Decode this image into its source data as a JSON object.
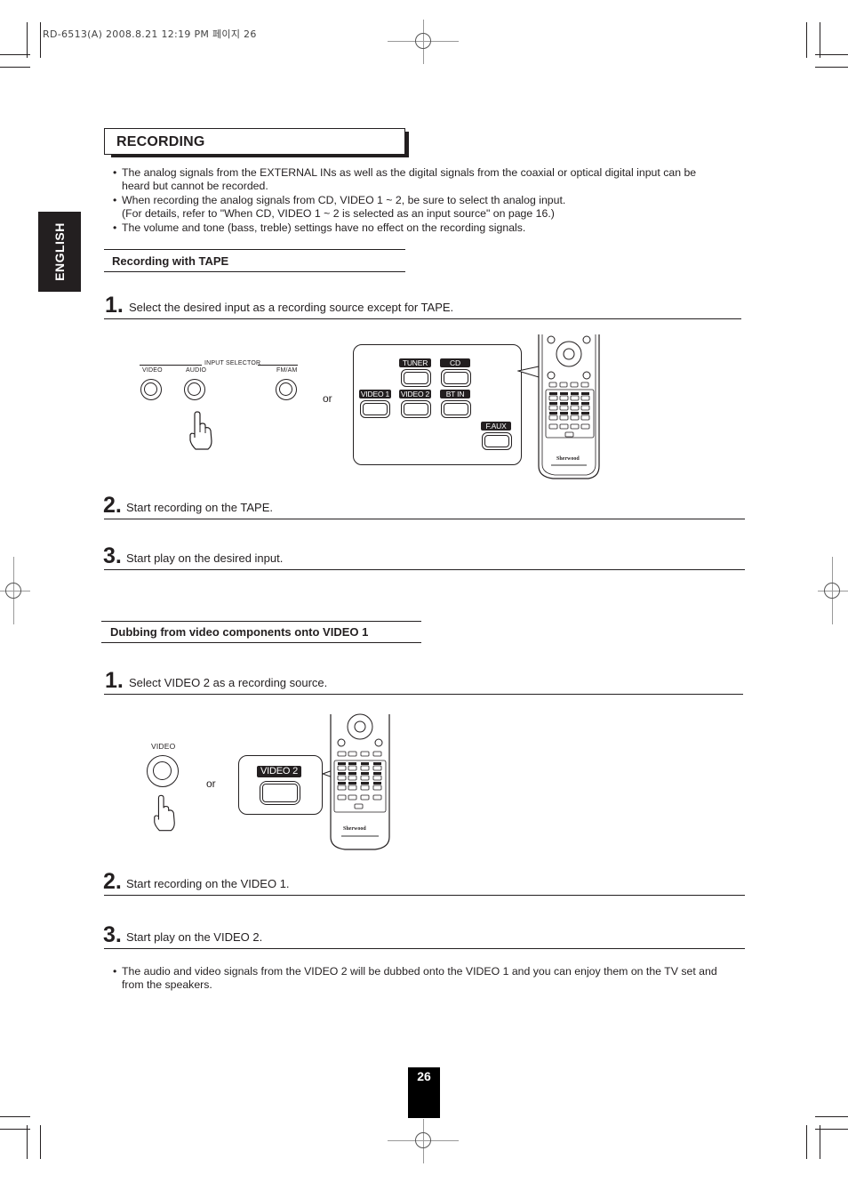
{
  "header": {
    "stamp": "RD-6513(A)  2008.8.21  12:19 PM  페이지 26"
  },
  "side_tab": {
    "language": "ENGLISH"
  },
  "section": {
    "title": "RECORDING",
    "notes": [
      "The analog signals from the EXTERNAL INs as well as the digital signals from the coaxial or optical digital input can be",
      "heard but cannot be recorded.",
      "When recording the analog signals from CD, VIDEO 1 ~ 2, be sure to select th analog input.",
      "(For details, refer to \"When CD, VIDEO 1 ~ 2 is selected as an input source\" on page 16.)",
      "The volume and tone (bass, treble) settings have no effect on the recording signals."
    ],
    "bullet": "•"
  },
  "tape": {
    "subtitle": "Recording with TAPE",
    "steps": [
      {
        "num": "1.",
        "text": "Select the desired input as a recording source except for TAPE."
      },
      {
        "num": "2.",
        "text": "Start recording on the TAPE."
      },
      {
        "num": "3.",
        "text": "Start play on the desired input."
      }
    ],
    "front_panel": {
      "group_label": "INPUT SELECTOR",
      "knobs": [
        "VIDEO",
        "AUDIO",
        "FM/AM"
      ]
    },
    "or": "or",
    "remote_buttons": [
      "TUNER",
      "CD",
      "VIDEO 1",
      "VIDEO 2",
      "BT IN",
      "F.AUX"
    ],
    "remote_brand": "Sherwood"
  },
  "dubbing": {
    "subtitle": "Dubbing from video components onto VIDEO 1",
    "steps": [
      {
        "num": "1.",
        "text": "Select VIDEO 2 as a recording source."
      },
      {
        "num": "2.",
        "text": "Start recording on the VIDEO 1."
      },
      {
        "num": "3.",
        "text": "Start play on the VIDEO 2."
      }
    ],
    "knob_label": "VIDEO",
    "or": "or",
    "remote_button": "VIDEO 2",
    "remote_brand": "Sherwood",
    "note": "The audio and video signals from the VIDEO 2 will be dubbed onto the VIDEO 1 and you can enjoy them on the TV set and",
    "note_cont": "from the speakers."
  },
  "footer": {
    "page_number": "26"
  }
}
